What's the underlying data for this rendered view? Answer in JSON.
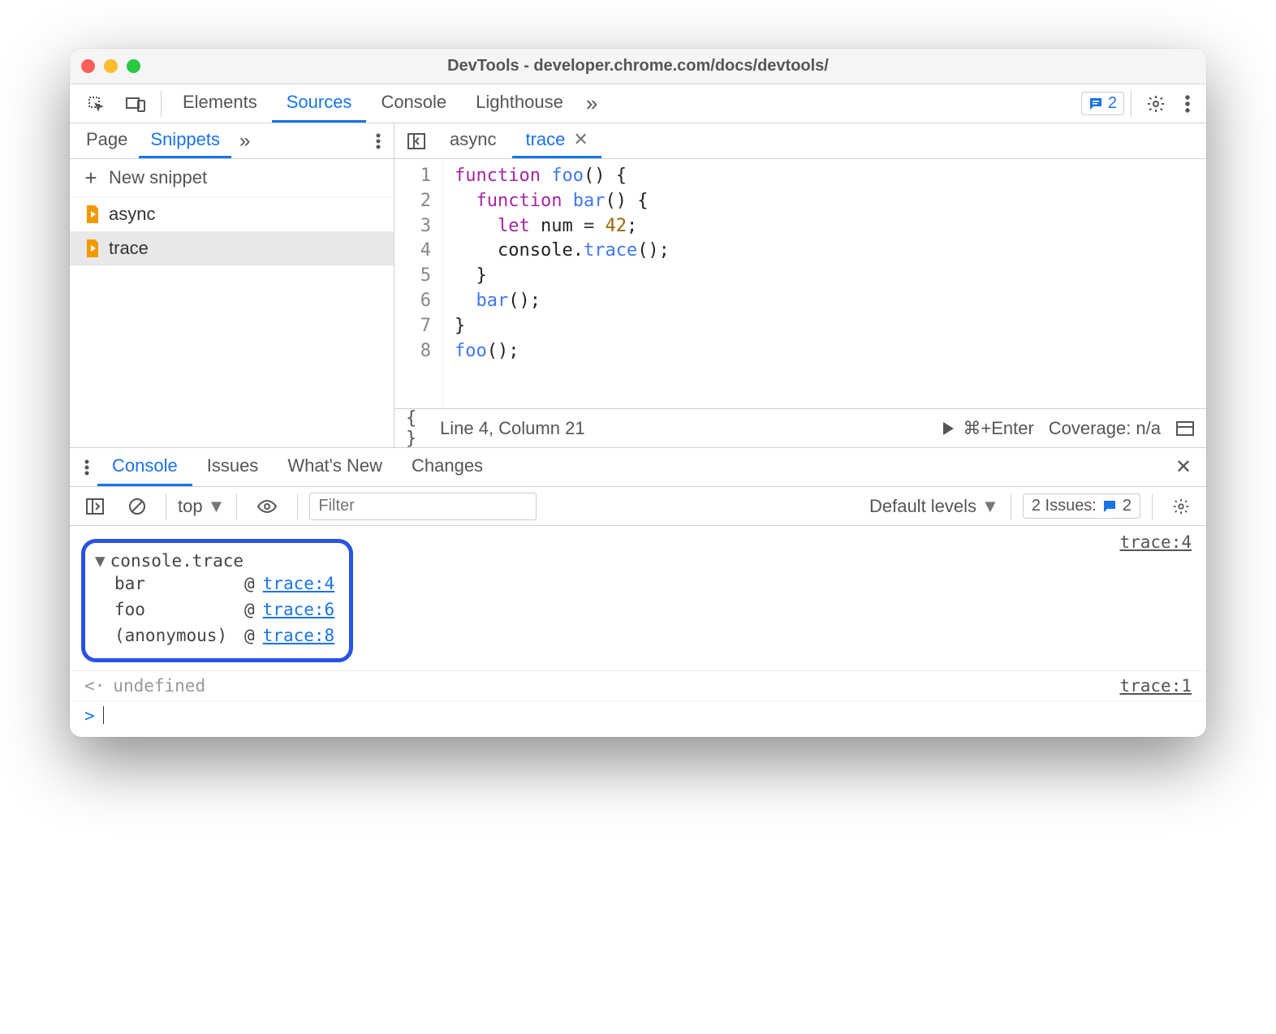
{
  "window": {
    "title": "DevTools - developer.chrome.com/docs/devtools/"
  },
  "mainTabs": {
    "elements": "Elements",
    "sources": "Sources",
    "console": "Console",
    "lighthouse": "Lighthouse"
  },
  "issuesBadge": {
    "count": "2"
  },
  "leftTabs": {
    "page": "Page",
    "snippets": "Snippets"
  },
  "newSnippet": "New snippet",
  "snippets": [
    "async",
    "trace"
  ],
  "editorTabs": {
    "async": "async",
    "trace": "trace"
  },
  "code": {
    "lines": [
      "1",
      "2",
      "3",
      "4",
      "5",
      "6",
      "7",
      "8"
    ]
  },
  "status": {
    "position": "Line 4, Column 21",
    "shortcut": "⌘+Enter",
    "coverage": "Coverage: n/a"
  },
  "drawerTabs": {
    "console": "Console",
    "issues": "Issues",
    "whatsnew": "What's New",
    "changes": "Changes"
  },
  "consoleToolbar": {
    "context": "top",
    "filterPlaceholder": "Filter",
    "levels": "Default levels",
    "issues": {
      "label": "2 Issues:",
      "count": "2"
    }
  },
  "trace": {
    "title": "console.trace",
    "frames": [
      {
        "name": "bar",
        "loc": "trace:4"
      },
      {
        "name": "foo",
        "loc": "trace:6"
      },
      {
        "name": "(anonymous)",
        "loc": "trace:8"
      }
    ],
    "srcLink": "trace:4"
  },
  "undefinedRow": {
    "text": "undefined",
    "srcLink": "trace:1"
  }
}
